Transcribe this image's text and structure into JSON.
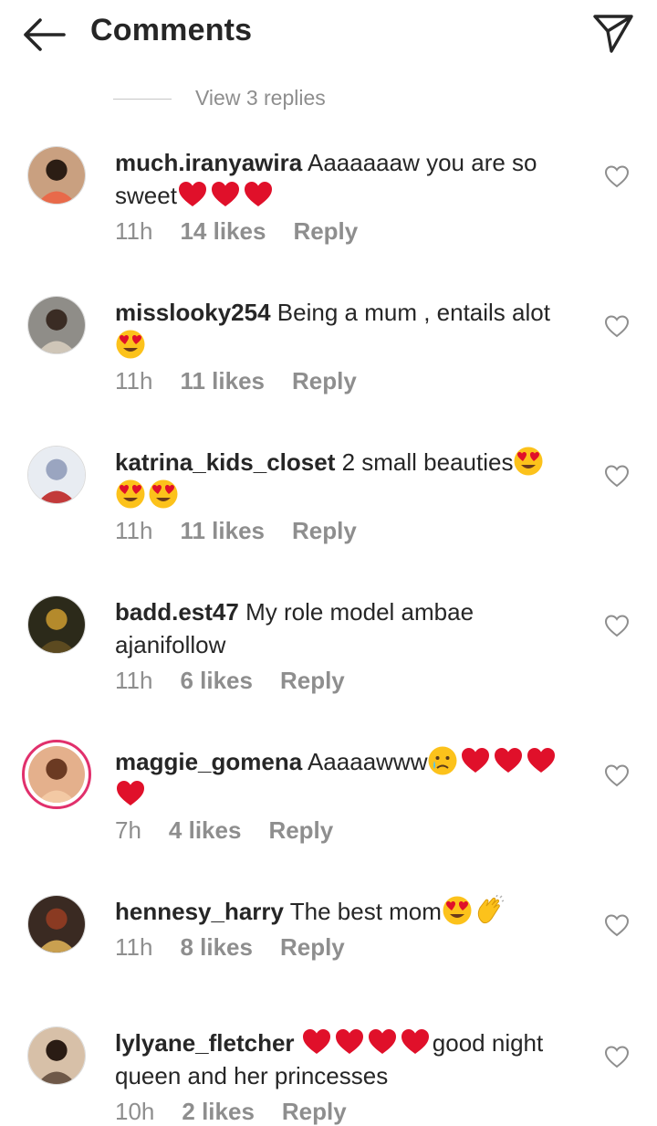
{
  "header": {
    "title": "Comments"
  },
  "view_replies": "View 3 replies",
  "comments": [
    {
      "username": "much.iranyawira",
      "text": "Aaaaaaaw you are so sweet",
      "time": "11h",
      "likes": "14 likes",
      "reply": "Reply",
      "emojis": [
        "heart-emoji",
        "heart-emoji",
        "heart-emoji"
      ]
    },
    {
      "username": "misslooky254",
      "text": "Being a mum , entails alot",
      "time": "11h",
      "likes": "11 likes",
      "reply": "Reply",
      "emojis": [
        "heart-eyes-emoji"
      ]
    },
    {
      "username": "katrina_kids_closet",
      "text": "2 small beauties",
      "time": "11h",
      "likes": "11 likes",
      "reply": "Reply",
      "emojis": [
        "heart-eyes-emoji",
        "heart-eyes-emoji",
        "heart-eyes-emoji"
      ]
    },
    {
      "username": "badd.est47",
      "text": "My role model ambae ajanifollow",
      "time": "11h",
      "likes": "6 likes",
      "reply": "Reply",
      "emojis": []
    },
    {
      "username": "maggie_gomena",
      "text": "Aaaaawww",
      "time": "7h",
      "likes": "4 likes",
      "reply": "Reply",
      "emojis": [
        "crying-face-emoji",
        "heart-emoji",
        "heart-emoji",
        "heart-emoji",
        "heart-emoji"
      ]
    },
    {
      "username": "hennesy_harry",
      "text": "The best mom",
      "time": "11h",
      "likes": "8 likes",
      "reply": "Reply",
      "emojis": [
        "heart-eyes-emoji",
        "clapping-hands-emoji"
      ]
    },
    {
      "username": "lylyane_fletcher",
      "text": "good night queen and her princesses",
      "time": "10h",
      "likes": "2 likes",
      "reply": "Reply",
      "emojis": [
        "heart-emoji",
        "heart-emoji",
        "heart-emoji",
        "heart-emoji"
      ]
    }
  ],
  "colors": {
    "text": "#262626",
    "secondary": "#8e8e8e",
    "story_ring": "#e1306c"
  }
}
